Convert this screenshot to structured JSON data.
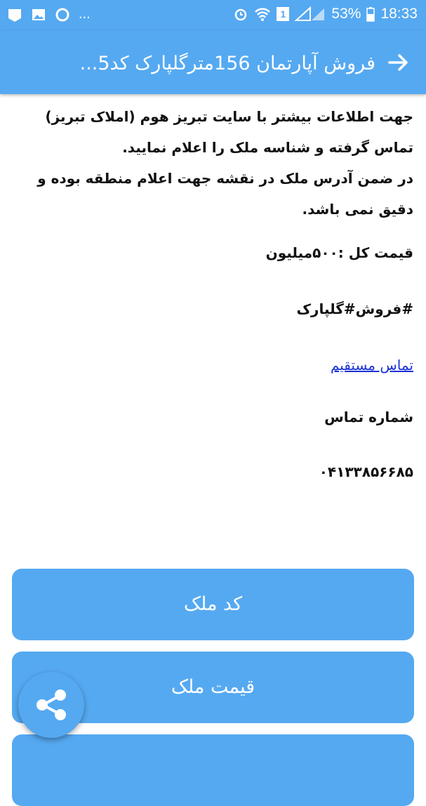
{
  "status_bar": {
    "left_icons": [
      "notification-icon",
      "image-icon",
      "sync-icon"
    ],
    "more": "...",
    "right_icons": [
      "alarm-icon",
      "wifi-icon",
      "sim-icon",
      "signal-icon"
    ],
    "sim_number": "1",
    "battery": "53%",
    "time": "18:33"
  },
  "app_bar": {
    "title": "فروش آپارتمان 156مترگلپارک کد5...",
    "back_icon": "arrow-right-icon"
  },
  "content": {
    "line1": "جهت اطلاعات بیشتر با سایت تبریز هوم (املاک تبریز)",
    "line2": "تماس گرفته و شناسه ملک را اعلام نمایید.",
    "line3": "در ضمن آدرس ملک در نقشه جهت اعلام منطقه بوده و",
    "line4": "دقیق نمی باشد.",
    "price": "قیمت کل :۵۰۰میلیون",
    "tag": "#فروش#گلپارک",
    "direct_contact": "تماس مستقیم",
    "phone_label": "شماره تماس",
    "phone": "۰۴۱۳۳۸۵۶۶۸۵"
  },
  "buttons": {
    "code": "کد ملک",
    "price": "قیمت ملک",
    "third": ""
  },
  "fab": {
    "icon": "share-icon"
  },
  "colors": {
    "primary": "#55a9f1",
    "link": "#1a32d6"
  }
}
